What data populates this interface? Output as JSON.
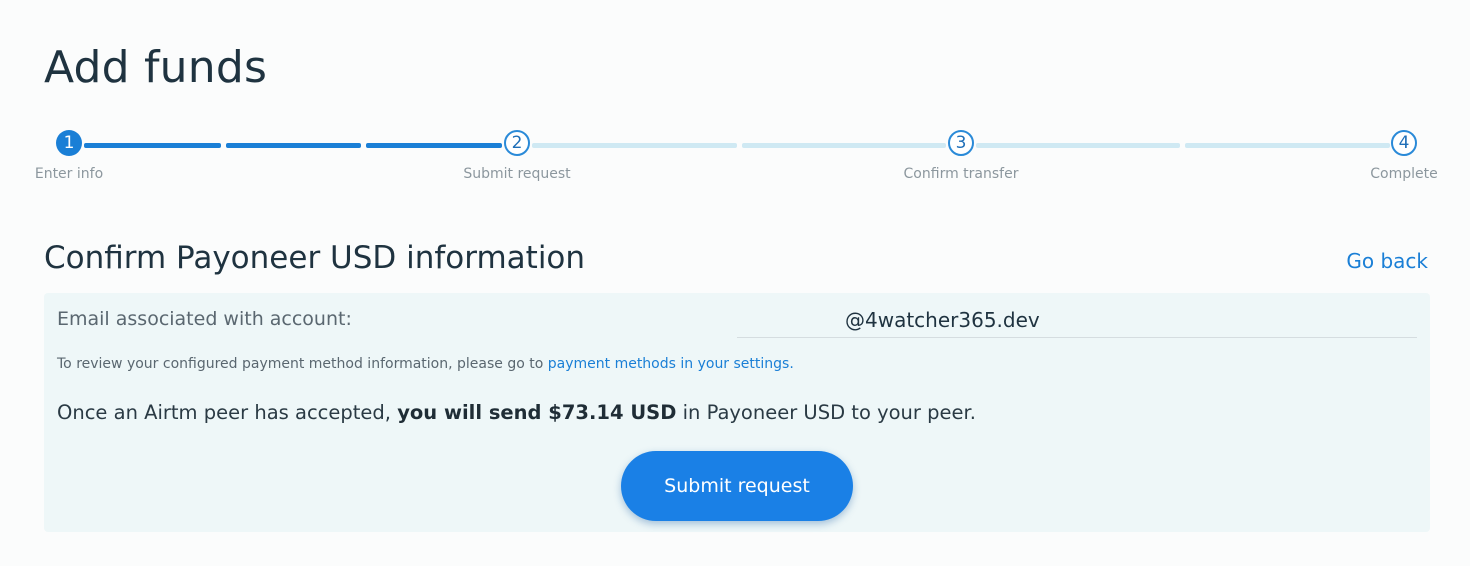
{
  "page": {
    "title": "Add funds"
  },
  "stepper": {
    "current_step": 1,
    "progress_fraction": 0.33,
    "steps": [
      {
        "number": "1",
        "label": "Enter info",
        "state": "active"
      },
      {
        "number": "2",
        "label": "Submit request",
        "state": "pending"
      },
      {
        "number": "3",
        "label": "Confirm transfer",
        "state": "pending"
      },
      {
        "number": "4",
        "label": "Complete",
        "state": "pending"
      }
    ]
  },
  "section": {
    "title": "Confirm Payoneer USD information",
    "go_back_label": "Go back"
  },
  "card": {
    "email_label": "Email associated with account:",
    "email_value": "@4watcher365.dev",
    "note_prefix": "To review your configured payment method information, please go to ",
    "note_link": "payment methods in your settings.",
    "info_prefix": "Once an Airtm peer has accepted, ",
    "info_bold": "you will send $73.14 USD",
    "info_suffix": " in Payoneer USD to your peer.",
    "submit_label": "Submit request"
  },
  "colors": {
    "accent": "#1a7fd6",
    "track_pending": "#cfe9f3",
    "card_bg": "#eef7f8",
    "heading": "#1f3340"
  }
}
